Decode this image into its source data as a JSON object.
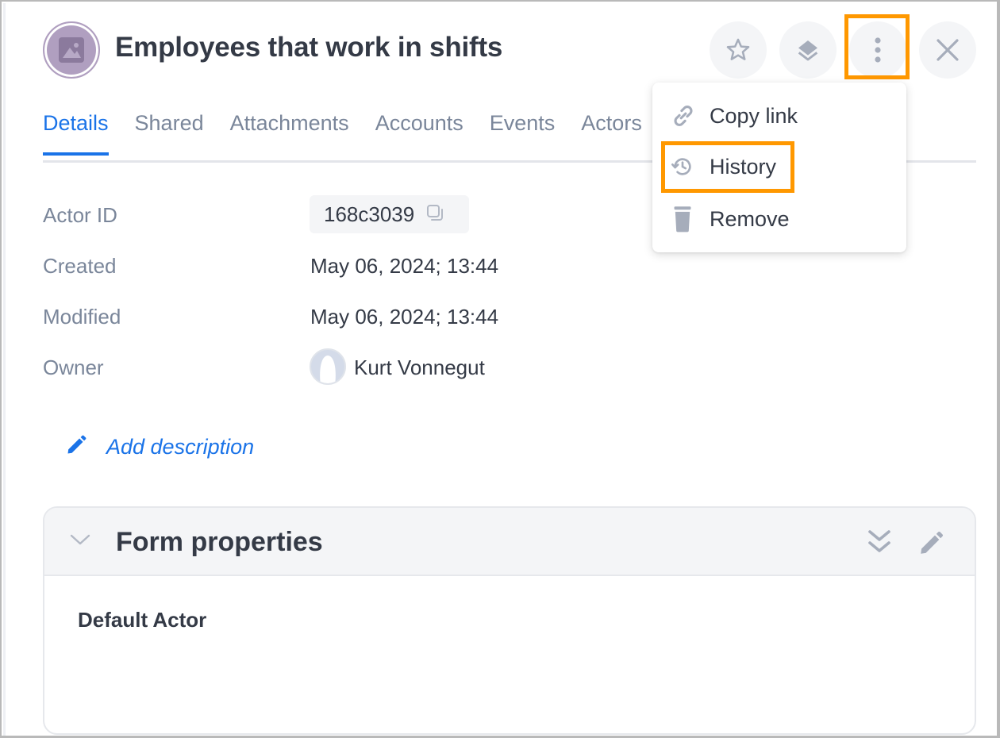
{
  "header": {
    "title": "Employees that work in shifts",
    "avatar_icon": "image-icon",
    "buttons": [
      {
        "name": "favorite",
        "icon": "star-icon"
      },
      {
        "name": "layers",
        "icon": "layers-icon"
      },
      {
        "name": "more-actions",
        "icon": "more-vertical-icon",
        "highlighted": true
      },
      {
        "name": "close",
        "icon": "close-icon"
      }
    ]
  },
  "tabs": [
    {
      "label": "Details",
      "active": true
    },
    {
      "label": "Shared",
      "active": false
    },
    {
      "label": "Attachments",
      "active": false
    },
    {
      "label": "Accounts",
      "active": false
    },
    {
      "label": "Events",
      "active": false
    },
    {
      "label": "Actors",
      "active": false
    }
  ],
  "menu": {
    "items": [
      {
        "label": "Copy link",
        "icon": "link-icon"
      },
      {
        "label": "History",
        "icon": "history-icon",
        "highlighted": true
      },
      {
        "label": "Remove",
        "icon": "trash-icon"
      }
    ]
  },
  "details": {
    "actor_id": {
      "label": "Actor ID",
      "value": "168c3039"
    },
    "created": {
      "label": "Created",
      "value": "May 06, 2024; 13:44"
    },
    "modified": {
      "label": "Modified",
      "value": "May 06, 2024; 13:44"
    },
    "owner": {
      "label": "Owner",
      "value": "Kurt Vonnegut"
    }
  },
  "add_description": "Add description",
  "form_properties": {
    "title": "Form properties",
    "body_title": "Default Actor"
  },
  "colors": {
    "accent": "#1a73e8",
    "highlight": "#ff9800",
    "text": "#343a46",
    "muted": "#7a869a",
    "avatar": "#b09fc0"
  }
}
